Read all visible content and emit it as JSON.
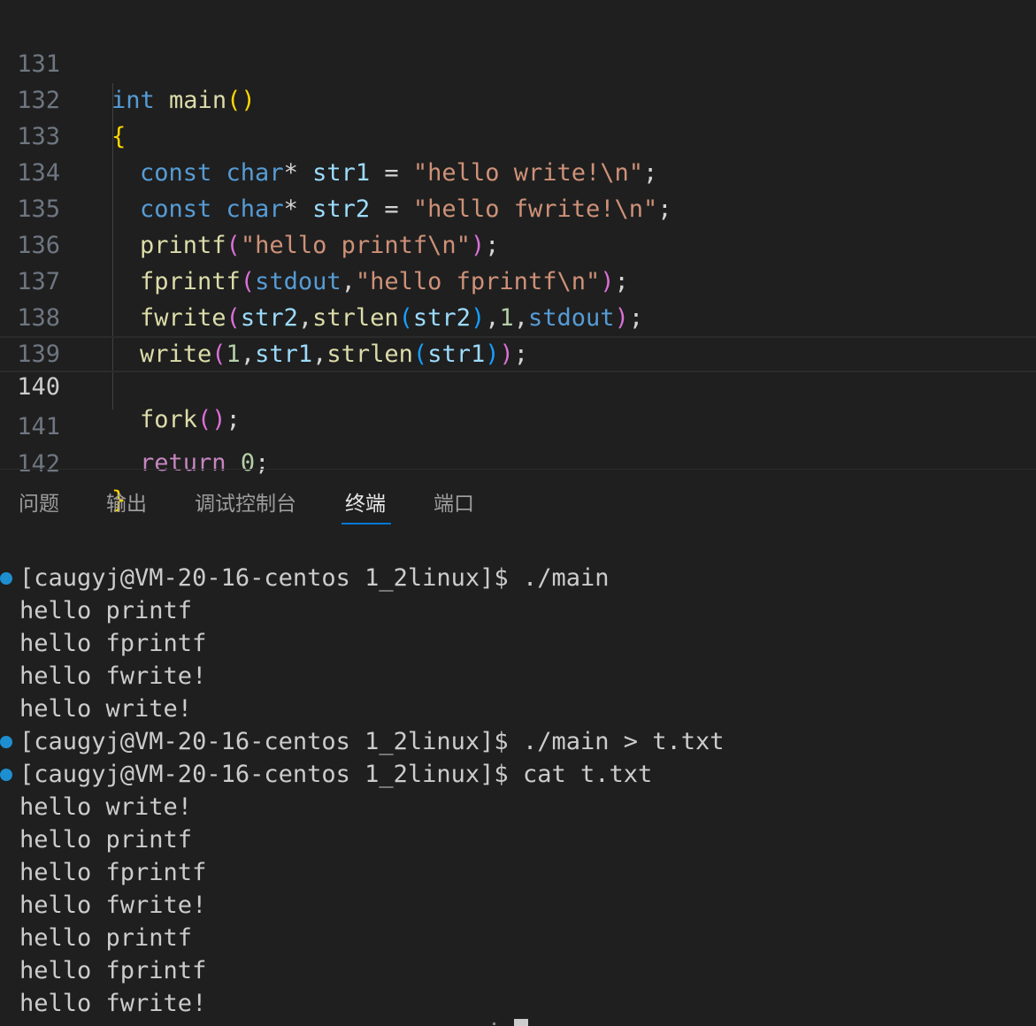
{
  "editor": {
    "lines": [
      {
        "num": "131"
      },
      {
        "num": "132"
      },
      {
        "num": "133"
      },
      {
        "num": "134"
      },
      {
        "num": "135"
      },
      {
        "num": "136"
      },
      {
        "num": "137"
      },
      {
        "num": "138"
      },
      {
        "num": "139"
      },
      {
        "num": "140"
      },
      {
        "num": "141"
      },
      {
        "num": "142"
      }
    ],
    "code": {
      "l131_kw": "int",
      "l131_fn": "main",
      "l131_p": "()",
      "l132": "{",
      "l133_kw1": "const",
      "l133_kw2": "char",
      "l133_star": "*",
      "l133_var": "str1",
      "l133_eq": " = ",
      "l133_str": "\"hello write!\\n\"",
      "l133_semi": ";",
      "l134_kw1": "const",
      "l134_kw2": "char",
      "l134_star": "*",
      "l134_var": "str2",
      "l134_eq": " = ",
      "l134_str": "\"hello fwrite!\\n\"",
      "l134_semi": ";",
      "l135_fn": "printf",
      "l135_po": "(",
      "l135_str": "\"hello printf\\n\"",
      "l135_pc": ")",
      "l135_semi": ";",
      "l136_fn": "fprintf",
      "l136_po": "(",
      "l136_var": "stdout",
      "l136_c": ",",
      "l136_str": "\"hello fprintf\\n\"",
      "l136_pc": ")",
      "l136_semi": ";",
      "l137_fn": "fwrite",
      "l137_po": "(",
      "l137_v1": "str2",
      "l137_c1": ",",
      "l137_fn2": "strlen",
      "l137_po2": "(",
      "l137_v2": "str2",
      "l137_pc2": ")",
      "l137_c2": ",",
      "l137_n": "1",
      "l137_c3": ",",
      "l137_v3": "stdout",
      "l137_pc": ")",
      "l137_semi": ";",
      "l138_fn": "write",
      "l138_po": "(",
      "l138_n": "1",
      "l138_c1": ",",
      "l138_v1": "str1",
      "l138_c2": ",",
      "l138_fn2": "strlen",
      "l138_po2": "(",
      "l138_v2": "str1",
      "l138_pc2": ")",
      "l138_pc": ")",
      "l138_semi": ";",
      "l140_fn": "fork",
      "l140_p": "()",
      "l140_semi": ";",
      "l141_kw": "return",
      "l141_n": "0",
      "l141_semi": ";",
      "l142": "}"
    }
  },
  "panel": {
    "tabs": [
      "问题",
      "输出",
      "调试控制台",
      "终端",
      "端口"
    ],
    "active_tab": "终端"
  },
  "terminal": {
    "lines": [
      {
        "text": "[caugyj@VM-20-16-centos 1_2linux]$ ./main",
        "prompt": true
      },
      {
        "text": "hello printf",
        "prompt": false
      },
      {
        "text": "hello fprintf",
        "prompt": false
      },
      {
        "text": "hello fwrite!",
        "prompt": false
      },
      {
        "text": "hello write!",
        "prompt": false
      },
      {
        "text": "[caugyj@VM-20-16-centos 1_2linux]$ ./main > t.txt",
        "prompt": true
      },
      {
        "text": "[caugyj@VM-20-16-centos 1_2linux]$ cat t.txt",
        "prompt": true
      },
      {
        "text": "hello write!",
        "prompt": false
      },
      {
        "text": "hello printf",
        "prompt": false
      },
      {
        "text": "hello fprintf",
        "prompt": false
      },
      {
        "text": "hello fwrite!",
        "prompt": false
      },
      {
        "text": "hello printf",
        "prompt": false
      },
      {
        "text": "hello fprintf",
        "prompt": false
      },
      {
        "text": "hello fwrite!",
        "prompt": false
      }
    ]
  },
  "colors": {
    "background": "#1f1f1f",
    "keyword": "#569cd6",
    "control_keyword": "#c586c0",
    "function": "#dcdcaa",
    "variable": "#9cdcfe",
    "string": "#ce9178",
    "number": "#b5cea8",
    "prompt_dot": "#1d8fd1",
    "tab_underline": "#0078d4"
  }
}
